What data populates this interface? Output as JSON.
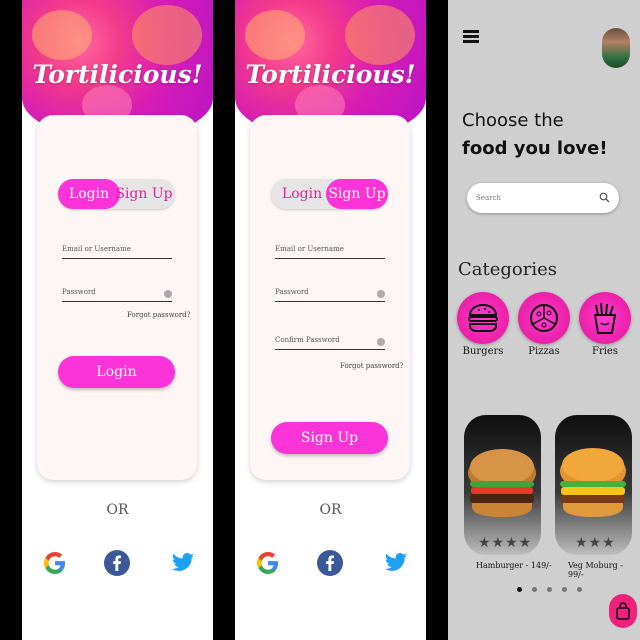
{
  "app": {
    "title": "Tortilicious!"
  },
  "login_screen": {
    "tabs": {
      "login": "Login",
      "signup": "Sign Up"
    },
    "email_placeholder": "Email or Username",
    "password_placeholder": "Password",
    "forgot": "Forgot password?",
    "submit": "Login",
    "or": "OR"
  },
  "signup_screen": {
    "tabs": {
      "login": "Login",
      "signup": "Sign Up"
    },
    "email_placeholder": "Email or Username",
    "password_placeholder": "Password",
    "confirm_placeholder": "Confirm Password",
    "forgot": "Forgot password?",
    "submit": "Sign Up",
    "or": "OR"
  },
  "social": [
    "google-icon",
    "facebook-icon",
    "twitter-icon"
  ],
  "home": {
    "heading_line1": "Choose the",
    "heading_line2": "food you love!",
    "search_placeholder": "Search",
    "categories_title": "Categories",
    "categories": [
      {
        "label": "Burgers",
        "icon": "burger-icon"
      },
      {
        "label": "Pizzas",
        "icon": "pizza-icon"
      },
      {
        "label": "Fries",
        "icon": "fries-icon"
      }
    ],
    "foods": [
      {
        "name": "Hamburger - 149/-",
        "stars": "★★★★"
      },
      {
        "name": "Veg Moburg - 99/-",
        "stars": "★★★"
      }
    ],
    "carousel": {
      "count": 5,
      "active": 1
    }
  },
  "colors": {
    "accent": "#fb33d8",
    "hero": "#e0229d",
    "bag": "#f0217c"
  }
}
